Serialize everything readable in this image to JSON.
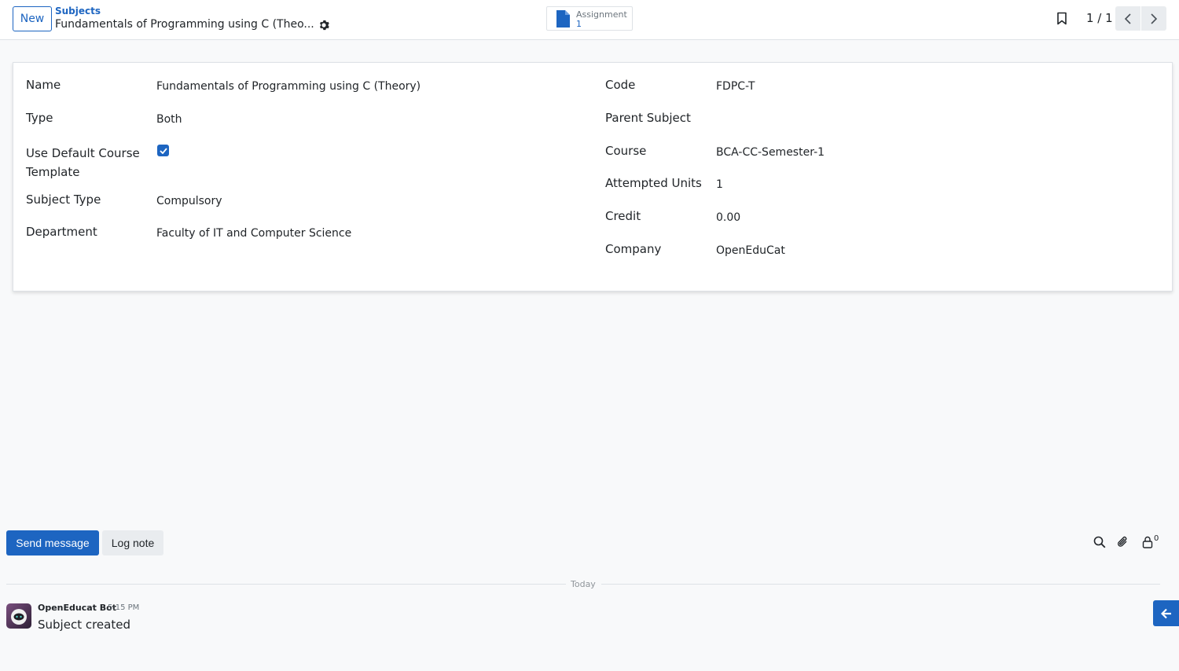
{
  "control_panel": {
    "new_label": "New",
    "breadcrumb_parent": "Subjects",
    "breadcrumb_current": "Fundamentals of Programming using C (Theo...",
    "smart_button": {
      "label": "Assignment",
      "count": "1"
    },
    "pager": "1 / 1"
  },
  "form": {
    "left": [
      {
        "label": "Name",
        "value": "Fundamentals of Programming using C (Theory)"
      },
      {
        "label": "Type",
        "value": "Both"
      },
      {
        "label": "Use Default Course Template",
        "value": ""
      },
      {
        "label": "Subject Type",
        "value": "Compulsory"
      },
      {
        "label": "Department",
        "value": "Faculty of IT and Computer Science"
      }
    ],
    "right": [
      {
        "label": "Code",
        "value": "FDPC-T"
      },
      {
        "label": "Parent Subject",
        "value": ""
      },
      {
        "label": "Course",
        "value": "BCA-CC-Semester-1"
      },
      {
        "label": "Attempted Units",
        "value": "1"
      },
      {
        "label": "Credit",
        "value": "0.00"
      },
      {
        "label": "Company",
        "value": "OpenEduCat"
      }
    ],
    "use_default_template_checked": true
  },
  "chatter": {
    "send_message": "Send message",
    "log_note": "Log note",
    "follower_count": "0",
    "date_separator": "Today",
    "messages": [
      {
        "author": "OpenEducat Bot",
        "time": "5:15 PM",
        "body": "Subject created"
      }
    ]
  },
  "colors": {
    "primary": "#1d65c1",
    "background": "#f8f9fa"
  }
}
